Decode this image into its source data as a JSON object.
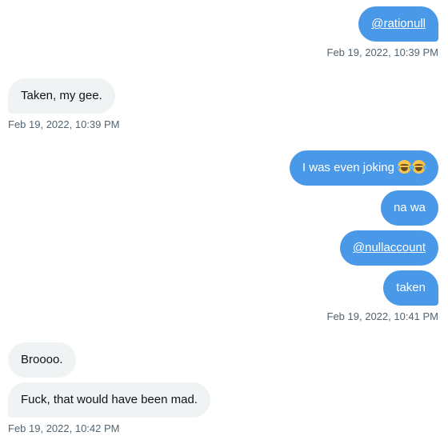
{
  "messages": [
    {
      "text": "@rationull",
      "timestamp": "Feb 19, 2022, 10:39 PM"
    },
    {
      "text": "Taken, my gee.",
      "timestamp": "Feb 19, 2022, 10:39 PM"
    },
    {
      "text": "I was even joking",
      "emoji": [
        "face-with-tears-of-joy-icon",
        "face-with-tears-of-joy-icon"
      ]
    },
    {
      "text": "na wa"
    },
    {
      "text": "@nullaccount"
    },
    {
      "text": "taken",
      "timestamp": "Feb 19, 2022, 10:41 PM"
    },
    {
      "text": "Broooo."
    },
    {
      "text": "Fuck, that would have been mad.",
      "timestamp": "Feb 19, 2022, 10:42 PM"
    }
  ],
  "colors": {
    "sent_bubble": "#4a99e9",
    "received_bubble": "#eff3f4",
    "timestamp_text": "#536471"
  }
}
